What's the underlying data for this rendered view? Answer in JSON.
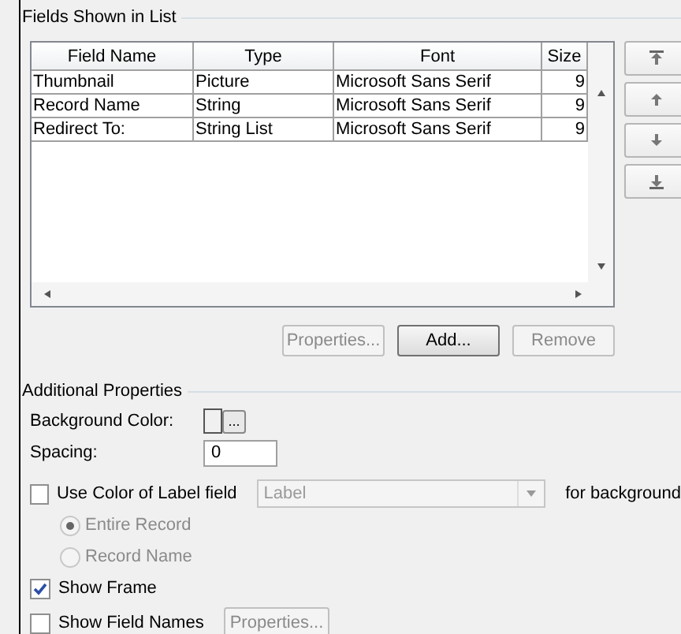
{
  "fields_group": {
    "title": "Fields Shown in List"
  },
  "table": {
    "columns": [
      "Field Name",
      "Type",
      "Font",
      "Size"
    ],
    "rows": [
      [
        "Thumbnail",
        "Picture",
        "Microsoft Sans Serif",
        "9"
      ],
      [
        "Record Name",
        "String",
        "Microsoft Sans Serif",
        "9"
      ],
      [
        "Redirect To:",
        "String List",
        "Microsoft Sans Serif",
        "9"
      ]
    ]
  },
  "buttons": [
    {
      "label": "Properties...",
      "disabled": true
    },
    {
      "label": "Add...",
      "disabled": false
    },
    {
      "label": "Remove",
      "disabled": true
    }
  ],
  "additional": {
    "title": "Additional Properties",
    "background_color": {
      "label": "Background Color:",
      "button": "..."
    },
    "spacing": {
      "label": "Spacing:",
      "value": "0"
    },
    "use_color": {
      "label": "Use Color of Label field",
      "checked": false,
      "dropdown": {
        "value": "Label",
        "disabled": true
      },
      "suffix": "for background"
    },
    "scope_options": [
      {
        "label": "Entire Record",
        "selected": true,
        "disabled": true
      },
      {
        "label": "Record Name",
        "selected": false,
        "disabled": true
      }
    ],
    "show_frame": {
      "label": "Show Frame",
      "checked": true
    },
    "show_field_names": {
      "label": "Show Field Names",
      "checked": false,
      "button": {
        "label": "Properties...",
        "disabled": true
      }
    }
  }
}
